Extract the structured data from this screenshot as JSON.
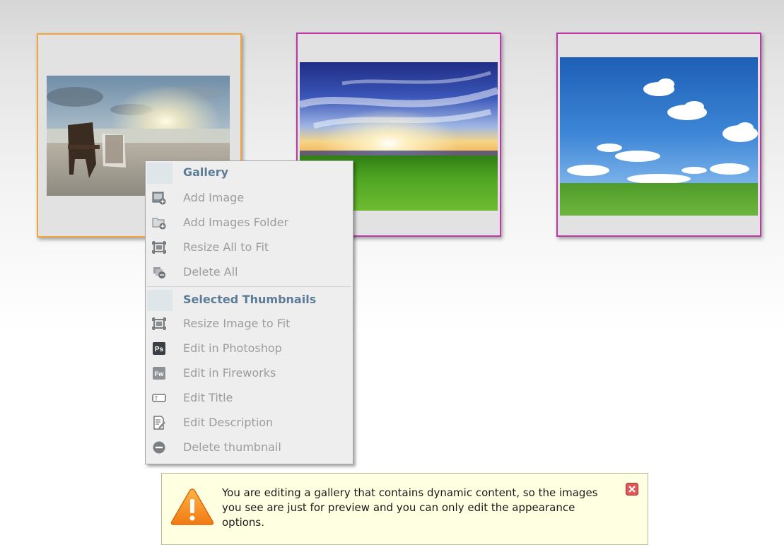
{
  "gallery": {
    "thumbnails": [
      {
        "name": "beach-sunset",
        "state": "selected",
        "border_color": "#f2a43a"
      },
      {
        "name": "sky-sunburst",
        "state": "normal",
        "border_color": "#c035a8"
      },
      {
        "name": "blue-sky-clouds",
        "state": "normal",
        "border_color": "#c035a8"
      }
    ]
  },
  "context_menu": {
    "gallery_header": "Gallery",
    "gallery_items": [
      {
        "label": "Add Image",
        "icon": "add-image-icon"
      },
      {
        "label": "Add Images Folder",
        "icon": "add-folder-icon"
      },
      {
        "label": "Resize All to Fit",
        "icon": "resize-icon"
      },
      {
        "label": "Delete All",
        "icon": "delete-all-icon"
      }
    ],
    "selected_header": "Selected Thumbnails",
    "selected_items": [
      {
        "label": "Resize Image to Fit",
        "icon": "resize-icon"
      },
      {
        "label": "Edit in Photoshop",
        "icon": "photoshop-icon"
      },
      {
        "label": "Edit in Fireworks",
        "icon": "fireworks-icon"
      },
      {
        "label": "Edit Title",
        "icon": "title-icon"
      },
      {
        "label": "Edit Description",
        "icon": "description-icon"
      },
      {
        "label": "Delete thumbnail",
        "icon": "delete-thumbnail-icon"
      }
    ],
    "icon_labels": {
      "photoshop": "Ps",
      "fireworks": "Fw",
      "title": "T"
    }
  },
  "notice": {
    "message": "You are editing a gallery that contains dynamic content, so the images you see are just for preview and you can only edit the appearance options.",
    "icon": "warning-icon",
    "close_icon": "close-icon"
  },
  "colors": {
    "selected_border": "#f2a43a",
    "thumb_border": "#c035a8",
    "menu_header": "#5b7b96",
    "menu_item_disabled": "#9c9c9c",
    "notice_bg": "#ffffe1"
  }
}
